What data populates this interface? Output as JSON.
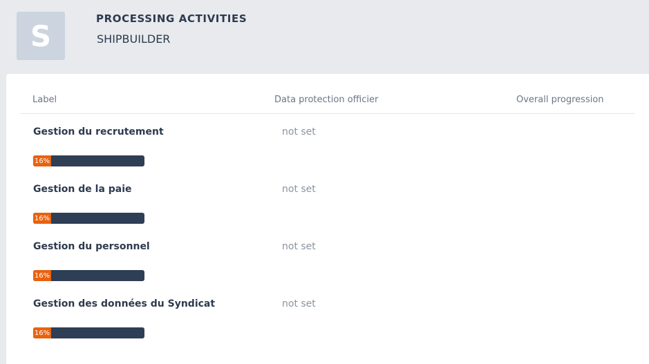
{
  "header": {
    "avatar_letter": "S",
    "title": "PROCESSING ACTIVITIES",
    "subtitle": "SHIPBUILDER"
  },
  "table": {
    "columns": {
      "label": "Label",
      "dpo": "Data protection officier",
      "progression": "Overall progression"
    },
    "rows": [
      {
        "label": "Gestion du recrutement",
        "dpo": "not set",
        "progress": 16,
        "progress_text": "16%"
      },
      {
        "label": "Gestion de la paie",
        "dpo": "not set",
        "progress": 16,
        "progress_text": "16%"
      },
      {
        "label": "Gestion du personnel",
        "dpo": "not set",
        "progress": 16,
        "progress_text": "16%"
      },
      {
        "label": "Gestion des données du Syndicat",
        "dpo": "not set",
        "progress": 16,
        "progress_text": "16%"
      }
    ]
  },
  "colors": {
    "background": "#e8eaee",
    "progress_fill": "#e8620f",
    "progress_track": "#2e3e55",
    "text_primary": "#2e3a4e"
  }
}
